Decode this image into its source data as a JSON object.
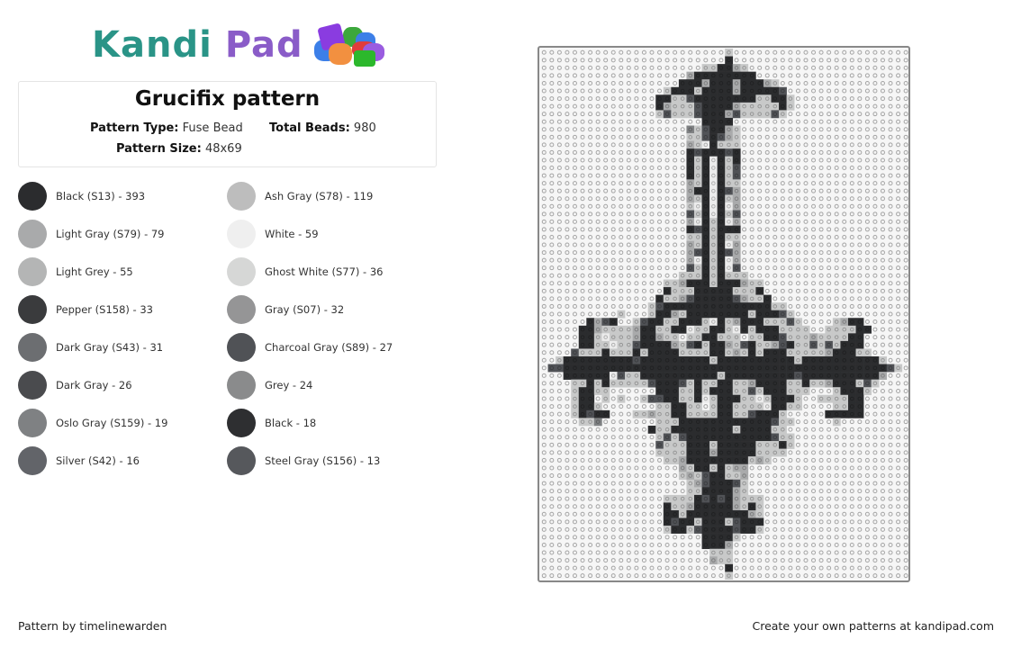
{
  "logo": {
    "part1": "Kandi",
    "part2": "Pad"
  },
  "pattern": {
    "title": "Grucifix pattern",
    "type_label": "Pattern Type:",
    "type_value": "Fuse Bead",
    "beads_label": "Total Beads:",
    "beads_value": "980",
    "size_label": "Pattern Size:",
    "size_value": "48x69"
  },
  "legend": [
    {
      "label": "Black (S13) - 393",
      "color": "#2b2c2e"
    },
    {
      "label": "Ash Gray (S78) - 119",
      "color": "#bdbdbd"
    },
    {
      "label": "Light Gray (S79) - 79",
      "color": "#a9aaab"
    },
    {
      "label": "White - 59",
      "color": "#efefef"
    },
    {
      "label": "Light Grey - 55",
      "color": "#b4b5b5"
    },
    {
      "label": "Ghost White (S77) - 36",
      "color": "#d6d7d6"
    },
    {
      "label": "Pepper (S158) - 33",
      "color": "#3a3b3d"
    },
    {
      "label": "Gray (S07) - 32",
      "color": "#959596"
    },
    {
      "label": "Dark Gray (S43) - 31",
      "color": "#6c6e71"
    },
    {
      "label": "Charcoal Gray (S89) - 27",
      "color": "#505256"
    },
    {
      "label": "Dark Gray - 26",
      "color": "#4a4b4e"
    },
    {
      "label": "Grey - 24",
      "color": "#8a8b8c"
    },
    {
      "label": "Oslo Gray (S159) - 19",
      "color": "#7f8183"
    },
    {
      "label": "Black - 18",
      "color": "#2e2f31"
    },
    {
      "label": "Silver (S42) - 16",
      "color": "#626469"
    },
    {
      "label": "Steel Gray (S156) - 13",
      "color": "#56585c"
    }
  ],
  "grid": {
    "cols": 48,
    "rows": 69,
    "palette": {
      "K": "#2b2c2e",
      "D": "#505256",
      "M": "#7f8183",
      "G": "#a9aaab",
      "L": "#c8c9c9",
      "W": "#ececec"
    },
    "cells": [
      "........................L.......................",
      "........................K.......................",
      ".....................LLKKGL.....................",
      "...................GKKKKKKKK....................",
      "..................KKKGKKKGKKKGL.................",
      "................LKKKLKKKKGKKKKKD................",
      "...............KKLLDKKKKKKKKLLKKL...............",
      "...............KGLLLDKKKKGLLLLLKL...............",
      "...............LDLLLDKKKGDLLLLDL................",
      ".....................KKKK.......................",
      "...................MLDKKGL......................",
      "...................LLDKDGL......................",
      "...................GLWKLLL......................",
      "...................KDKKKDK......................",
      "...................KLKWKLK......................",
      "...................KLKWKLD......................",
      "...................KLKWKLD......................",
      "...................GLKWKLL......................",
      "...................GKKWKDG......................",
      "...................GLKWKLG......................",
      "...................LWKWKWG......................",
      "...................DLKWKLD......................",
      "...................GWKLKWG......................",
      "...................KDKLKKK......................",
      "...................LLKLKLL......................",
      "...................GLKLKWG......................",
      "...................GDKLKDG......................",
      "...................GWKLKWG......................",
      "...................DLKLKWD......................",
      "..................LLLKLKLLL.....................",
      "................LLGKKKLKKKGLL...................",
      "................KLLLKKKKKLLLK...................",
      "...............KLLGDKKKKKDGLLK..................",
      "..............LDKKKKKKKKKKKKKKLL................",
      "..........L...LKKGLKKKKKKKKLKKKDL...............",
      "......KGDK..LDKKLLKKKLWKLGKKKLLLDL....LGKK......",
      ".....KKGLLLLGKKLLKKWLLKKLWKLKKKLLLL..LLLLKK.....",
      ".....KKLWLLLGKKGLL.LLKKLLL.LLKKDLLLGLLLLKK......",
      ".....KKLLWLLDKKKKGLDKLKKGLDKLLGDKLLDLDLKKK......",
      "....DLLLKLLLKLKKKKLLLLKKLGLKLKKKLLLLLGKKKLL.....",
      "..LKKKKKKKKKDKKKKKKKKKLKKKKKKKKKKLKKKKKKKKKKL...",
      ".DDKKKKKKKKKKKKKKKKKKKKKKKKKKKKKKKKKKKKKKKKKKDL.",
      "...KKKKKKWDLLKKKKKKKKKKLKKKKKKKKKDKKKKKKKKKKG...",
      "....LLKLKLLLLLDKKKDLKLLKKLLGKKKKLLKLLGKKKLDL....",
      "....LKKLL......KKKLLKLKKKLLDLKKKLLL...LKKKL.....",
      "....LKK.L.L..LDDKKLLKWLKKKLLWLKKKL..LLLLKK......",
      "....LKKL.......LLKKLL.LKKLLLLWKKLL....LLKK......",
      "....LKDKK...LLGLLKKLLLLKKLLDKKKL.....KKKKK......",
      ".....LLM.......LLLKKKKKKKKKKKKDLL.....L.........",
      "..............KLLKKKKKKKKLKKKKLL................",
      "...............LDLDKKKKKKKKKKKDLL...............",
      "...............DLLLKKKLKKKKKLLLKL...............",
      "...............LLLLKKKGKKKKKLLLL................",
      "................LLGKKKKKKKKLGL..................",
      "..................GLKKLKLGG.....................",
      "..................LGLDKKLLG.....................",
      "...................LGDKKKDL.....................",
      "...................LLKKKKGL.....................",
      "................LLLLKDKDKGLLL...................",
      "................KLLGKKKKKGLKL...................",
      "................KKLKKKKKKKKGL...................",
      "................KDKKLKKKLDKKK...................",
      "................LKKLDKKKKDKKL...................",
      ".....................KKKKL......................",
      ".....................KKKG.......................",
      "......................LLL.......................",
      "......................GLL.......................",
      "........................K.......................",
      "........................L......................."
    ]
  },
  "footer": {
    "credit": "Pattern by timelinewarden",
    "cta": "Create your own patterns at kandipad.com"
  }
}
